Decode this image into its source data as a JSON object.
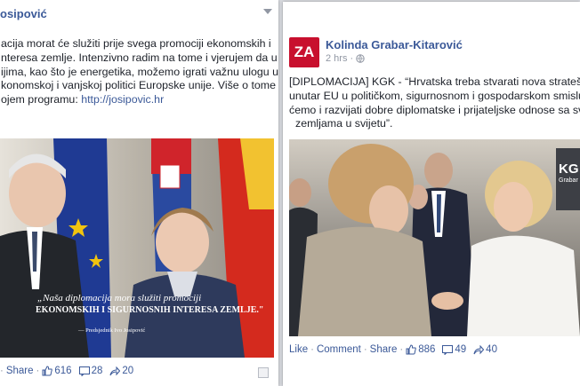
{
  "left_post": {
    "author": "osipović",
    "text_lines": [
      "acija morat će služiti prije svega promociji ekonomskih i",
      "nteresa zemlje. Intenzivno radim na tome i vjerujem da u",
      "ijima, kao što je energetika, možemo igrati važnu ulogu u",
      "konomskoj i vanjskoj politici Europske unije. Više o tome",
      "ojem programu: "
    ],
    "link": "http://josipovic.hr",
    "photo_quote_line1": "„Naša diplomacija mora služiti promociji",
    "photo_quote_line2": "EKONOMSKIH I SIGURNOSNIH INTERESA ZEMLJE.\"",
    "photo_attribution": "— Predsjednik Ivo Josipović",
    "footer": {
      "share": "Share",
      "likes": "616",
      "comments": "28",
      "shares": "20"
    }
  },
  "right_post": {
    "avatar_text": "ZA",
    "author": "Kolinda Grabar-Kitarović",
    "time": "2 hrs",
    "text_lines": [
      "[DIPLOMACIJA] KGK - “Hrvatska treba stvarati nova strateška",
      "unutar EU u političkom, sigurnosnom i gospodarskom smislu.",
      "ćemo i razvijati dobre diplomatske i prijateljske odnose sa svim",
      "zemljama u svijetu”."
    ],
    "photo_sign": "KG",
    "photo_sign_sub": "Grabar",
    "footer": {
      "like": "Like",
      "comment": "Comment",
      "share": "Share",
      "likes": "886",
      "comments": "49",
      "shares": "40"
    }
  },
  "colors": {
    "link_blue": "#3b5998",
    "avatar_red": "#c8102e"
  }
}
